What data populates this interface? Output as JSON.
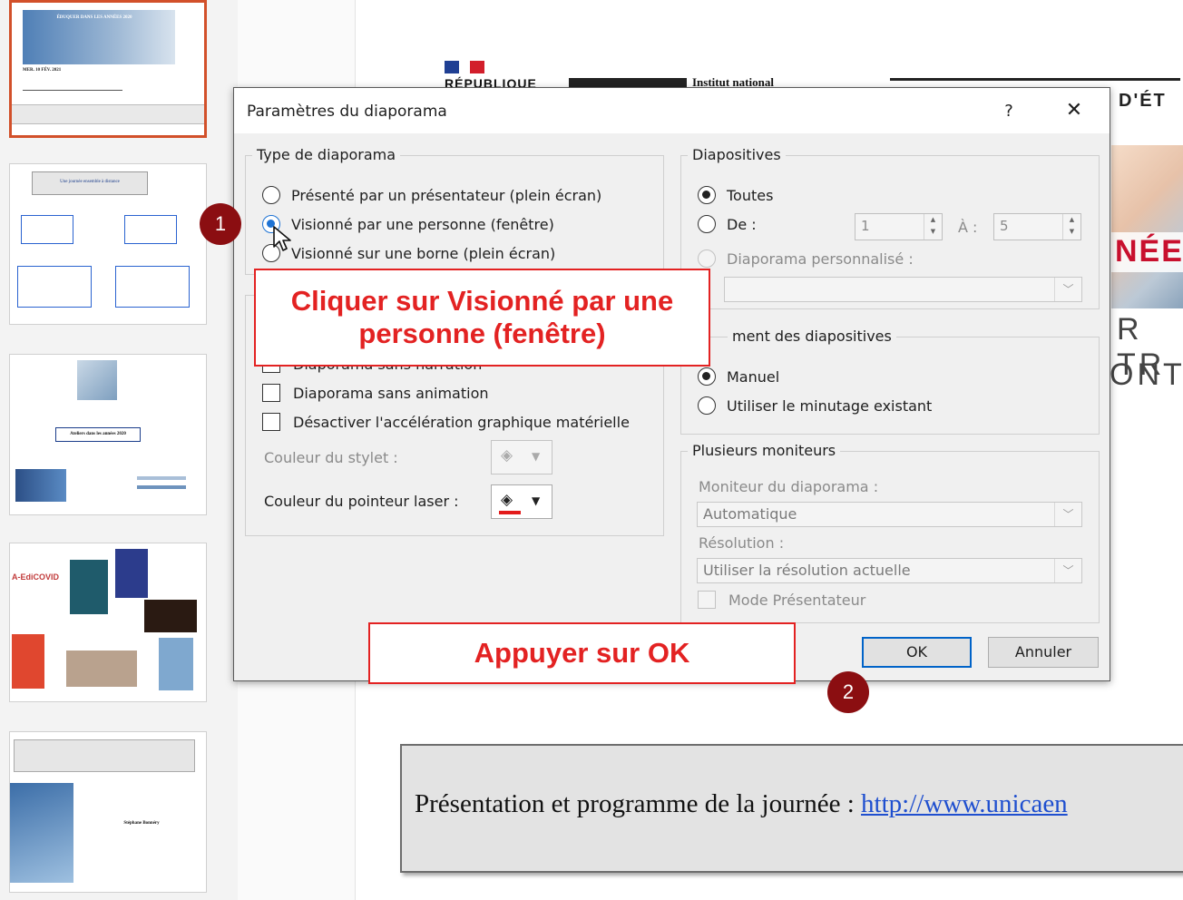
{
  "slide_background": {
    "republique_text": "RÉPUBLIQUE",
    "institut_text": "Institut national",
    "detat_text": "D'ÉT",
    "nees_text": "NÉES",
    "rtr_text": "R TR",
    "ont_text": "ONT",
    "presentation_text": "Présentation et programme de la journée : ",
    "presentation_link": "http://www.unicaen"
  },
  "dialog": {
    "title": "Paramètres du diaporama",
    "help_label": "?",
    "close_label": "✕",
    "type_group": {
      "title": "Type de diaporama",
      "options": [
        {
          "label": "Présenté par un présentateur (plein écran)",
          "checked": false
        },
        {
          "label": "Visionné par une personne (fenêtre)",
          "checked": true
        },
        {
          "label": "Visionné sur une borne (plein écran)",
          "checked": false
        }
      ]
    },
    "options_group": {
      "checkbox_hidden_label": "Diaporama sans narration",
      "checkbox_animation_label": "Diaporama sans animation",
      "checkbox_hwaccel_label": "Désactiver l'accélération graphique matérielle",
      "pen_color_label": "Couleur du stylet :",
      "laser_color_label": "Couleur du pointeur laser :",
      "laser_color": "#e31b1b"
    },
    "slides_group": {
      "title": "Diapositives",
      "all_label": "Toutes",
      "from_label": "De :",
      "from_value": "1",
      "to_label": "À :",
      "to_value": "5",
      "custom_label": "Diaporama personnalisé :"
    },
    "advance_group": {
      "title": "ment des diapositives",
      "manual_label": "Manuel",
      "timing_label": "Utiliser le minutage existant"
    },
    "monitors_group": {
      "title": "Plusieurs moniteurs",
      "monitor_label": "Moniteur du diaporama :",
      "monitor_value": "Automatique",
      "resolution_label": "Résolution :",
      "resolution_value": "Utiliser la résolution actuelle",
      "presenter_mode_label": "Mode Présentateur"
    },
    "ok_label": "OK",
    "cancel_label": "Annuler"
  },
  "annotations": {
    "callout1_text": "Cliquer sur Visionné par une personne (fenêtre)",
    "callout2_text": "Appuyer sur OK",
    "badge1": "1",
    "badge2": "2",
    "callout_color": "#e32222",
    "badge_color": "#8b0e11"
  },
  "thumbnails": {
    "slide1_headline": "ÉDUQUER DANS LES ANNÉES 2020",
    "slide1_date": "MER. 10 FÉV. 2021",
    "slide2_title": "Une journée ensemble à distance",
    "slide3_title": "Ateliers dans les années 2020",
    "slide4_label": "A-EdiCOVID",
    "slide5_title": "Stéphane Bonnéry"
  }
}
